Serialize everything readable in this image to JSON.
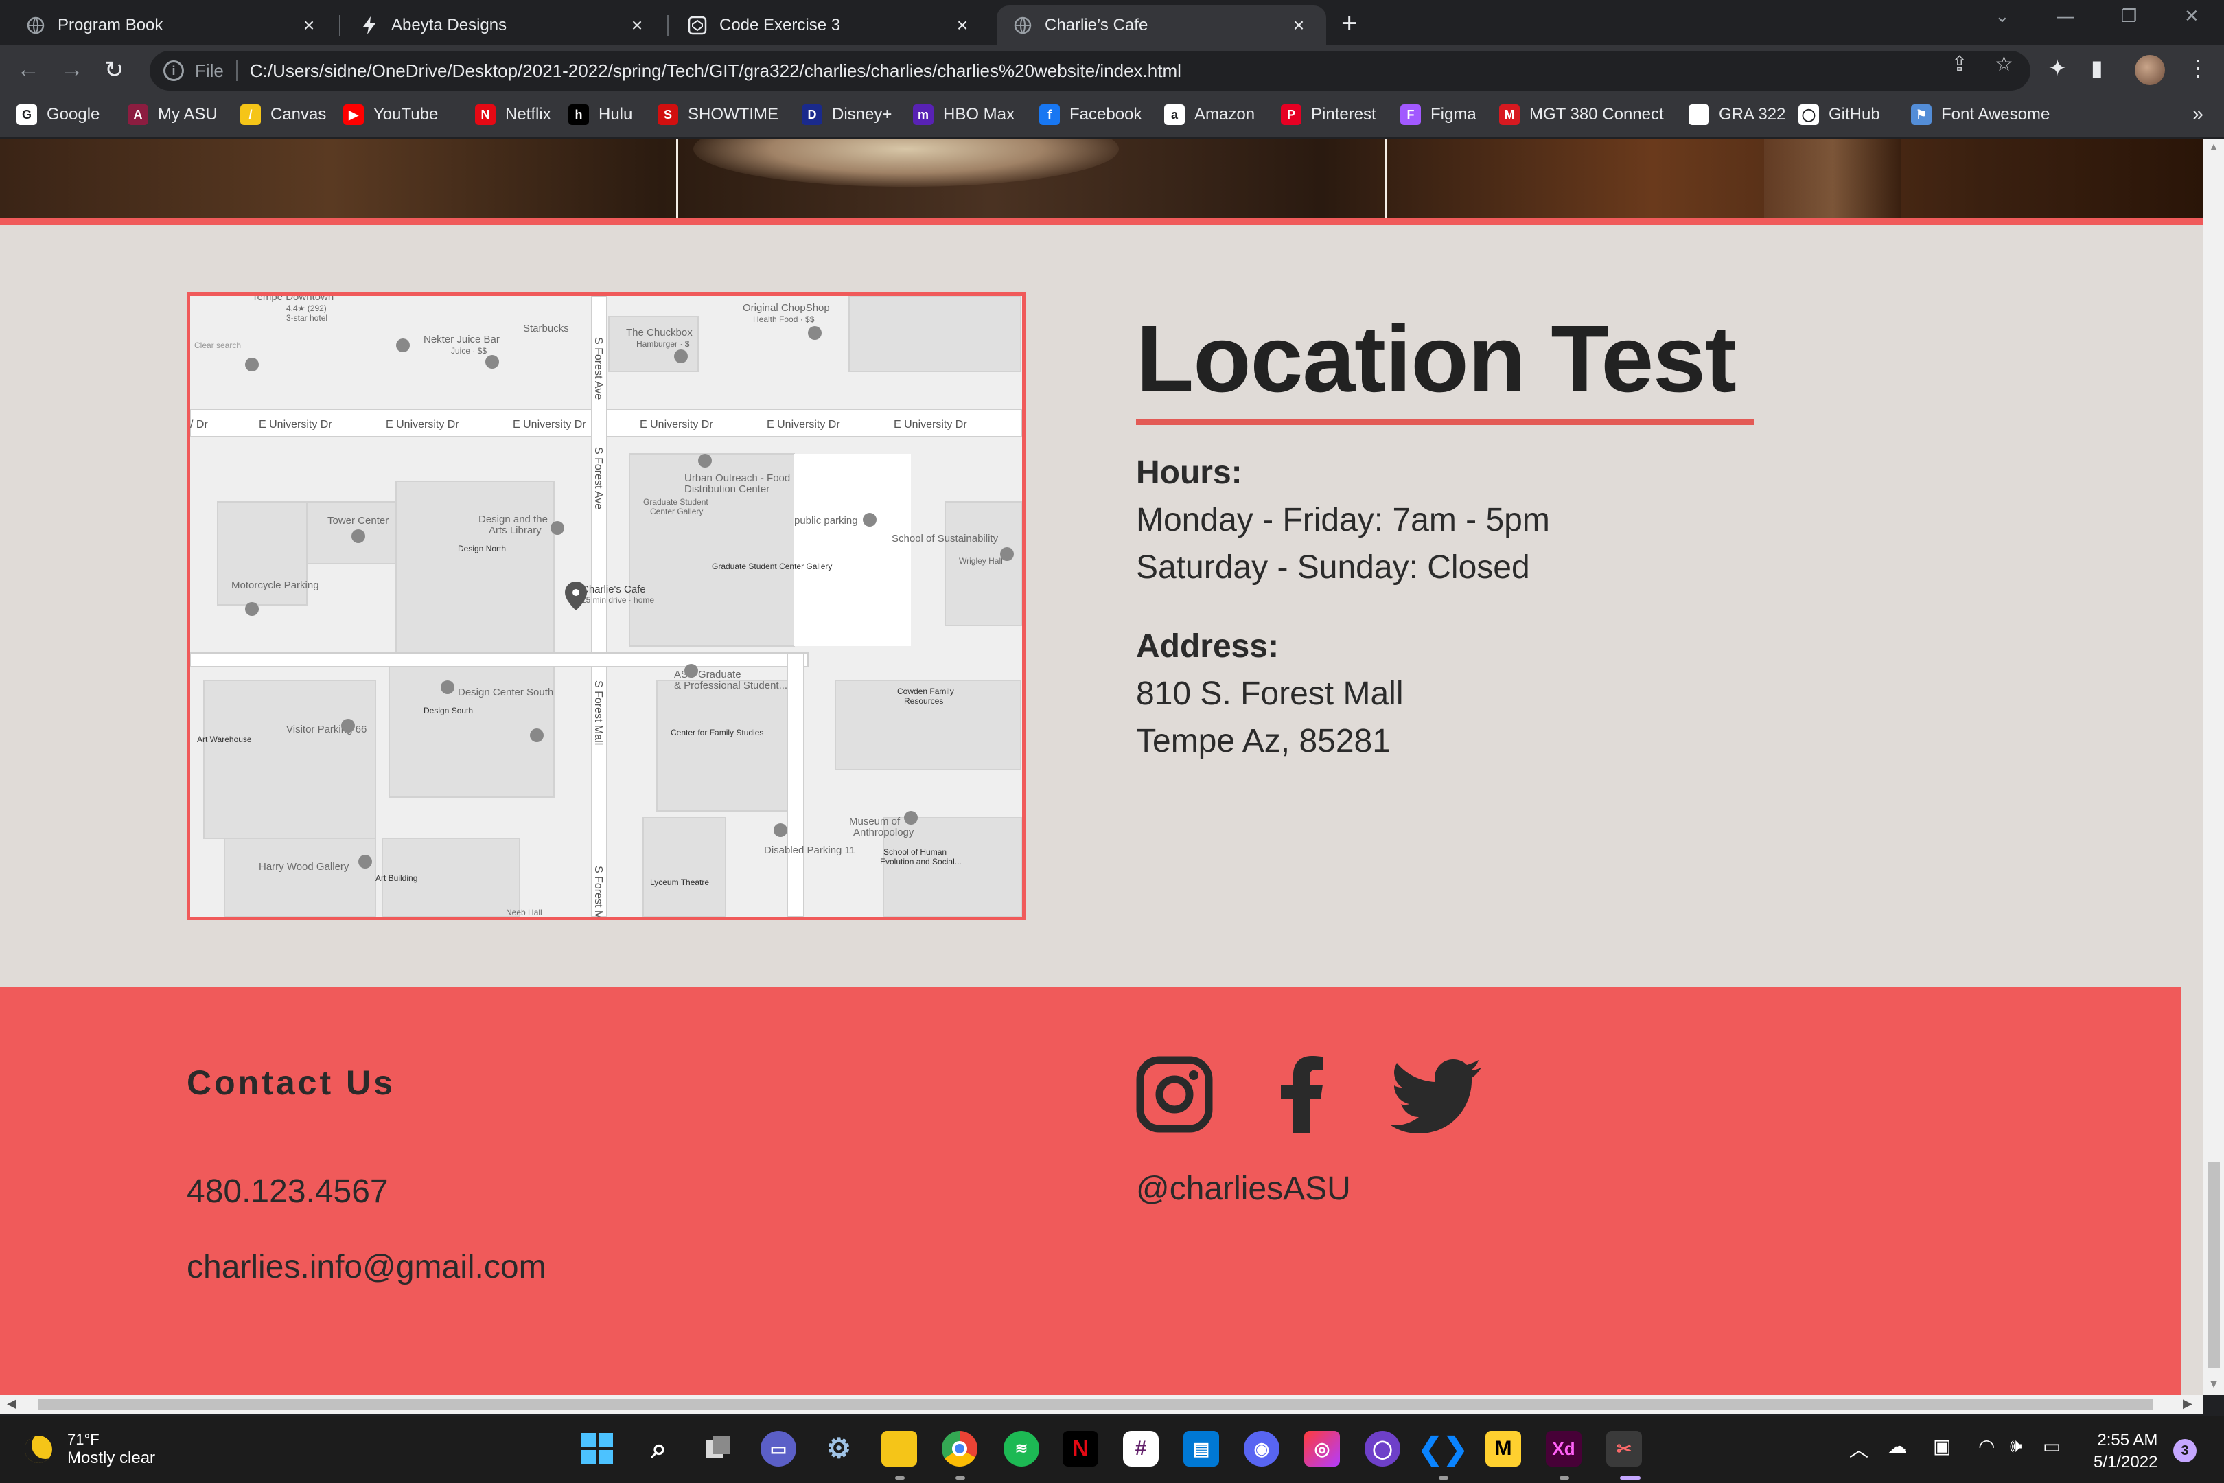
{
  "browser": {
    "tabs": [
      {
        "title": "Program Book",
        "active": false
      },
      {
        "title": "Abeyta Designs",
        "active": false
      },
      {
        "title": "Code Exercise 3",
        "active": false
      },
      {
        "title": "Charlie’s Cafe",
        "active": true
      }
    ],
    "new_tab": "+",
    "address": {
      "scheme": "File",
      "url": "C:/Users/sidne/OneDrive/Desktop/2021-2022/spring/Tech/GIT/gra322/charlies/charlies/charlies%20website/index.html"
    },
    "bookmarks": [
      {
        "label": "Google",
        "color": "#ffffff",
        "glyph": "G"
      },
      {
        "label": "My ASU",
        "color": "#8c1d40",
        "glyph": "A"
      },
      {
        "label": "Canvas",
        "color": "#f5c518",
        "glyph": "/"
      },
      {
        "label": "YouTube",
        "color": "#ff0000",
        "glyph": "▶"
      },
      {
        "label": "Netflix",
        "color": "#e50914",
        "glyph": "N"
      },
      {
        "label": "Hulu",
        "color": "#000000",
        "glyph": "h"
      },
      {
        "label": "SHOWTIME",
        "color": "#d20f0f",
        "glyph": "S"
      },
      {
        "label": "Disney+",
        "color": "#1a2a8c",
        "glyph": "D"
      },
      {
        "label": "HBO Max",
        "color": "#5822b4",
        "glyph": "m"
      },
      {
        "label": "Facebook",
        "color": "#1877f2",
        "glyph": "f"
      },
      {
        "label": "Amazon",
        "color": "#ffffff",
        "glyph": "a"
      },
      {
        "label": "Pinterest",
        "color": "#e60023",
        "glyph": "P"
      },
      {
        "label": "Figma",
        "color": "#a259ff",
        "glyph": "F"
      },
      {
        "label": "MGT 380 Connect",
        "color": "#d71920",
        "glyph": "M"
      },
      {
        "label": "GRA 322",
        "color": "#ffffff",
        "glyph": ""
      },
      {
        "label": "GitHub",
        "color": "#ffffff",
        "glyph": "◯"
      },
      {
        "label": "Font Awesome",
        "color": "#538dd7",
        "glyph": "⚑"
      }
    ],
    "more": "»"
  },
  "location": {
    "title": "Location Test",
    "hours_label": "Hours:",
    "hours": [
      "Monday - Friday: 7am - 5pm",
      "Saturday - Sunday: Closed"
    ],
    "address_label": "Address:",
    "address": [
      "810 S. Forest Mall",
      "Tempe Az, 85281"
    ]
  },
  "map": {
    "streets": {
      "e_university": "E University Dr",
      "s_forest_ave": "S Forest Ave",
      "s_forest_mall": "S Forest Mall"
    },
    "places": [
      "Tempe Downtown",
      "4.4★ (292)",
      "3-star hotel",
      "Clear search",
      "Nekter Juice Bar",
      "Juice · $$",
      "Starbucks",
      "The Chuckbox",
      "Hamburger · $",
      "Original ChopShop",
      "Health Food · $$",
      "Urban Outreach - Food",
      "Distribution Center",
      "Graduate Student",
      "Center Gallery",
      "public parking",
      "School of Sustainability",
      "Wrigley Hall",
      "Tower Center",
      "Design and the",
      "Arts Library",
      "Design North",
      "Charlie's Cafe",
      "15 min drive · home",
      "Motorcycle Parking",
      "ASU Graduate",
      "& Professional Student...",
      "Cowden Family",
      "Resources",
      "Design Center South",
      "Design South",
      "Visitor Parking 66",
      "Art Warehouse",
      "Center for Family Studies",
      "Museum of",
      "Anthropology",
      "School of Human",
      "Evolution and Social...",
      "Disabled Parking 11",
      "Harry Wood Gallery",
      "Art Building",
      "Lyceum Theatre",
      "Neeb Hall",
      "Graduate Student Center Gallery"
    ]
  },
  "footer": {
    "contact_title": "Contact Us",
    "phone": "480.123.4567",
    "email": "charlies.info@gmail.com",
    "handle": "@charliesASU",
    "social_icons": [
      "instagram-icon",
      "facebook-icon",
      "twitter-icon"
    ],
    "background": "#f05a5a"
  },
  "taskbar": {
    "weather_temp": "71°F",
    "weather_cond": "Mostly clear",
    "time": "2:55 AM",
    "date": "5/1/2022",
    "notifications": "3"
  },
  "colors": {
    "accent_red": "#f05a5a",
    "page_bg": "#e0dbd7",
    "text_dark": "#222222"
  }
}
